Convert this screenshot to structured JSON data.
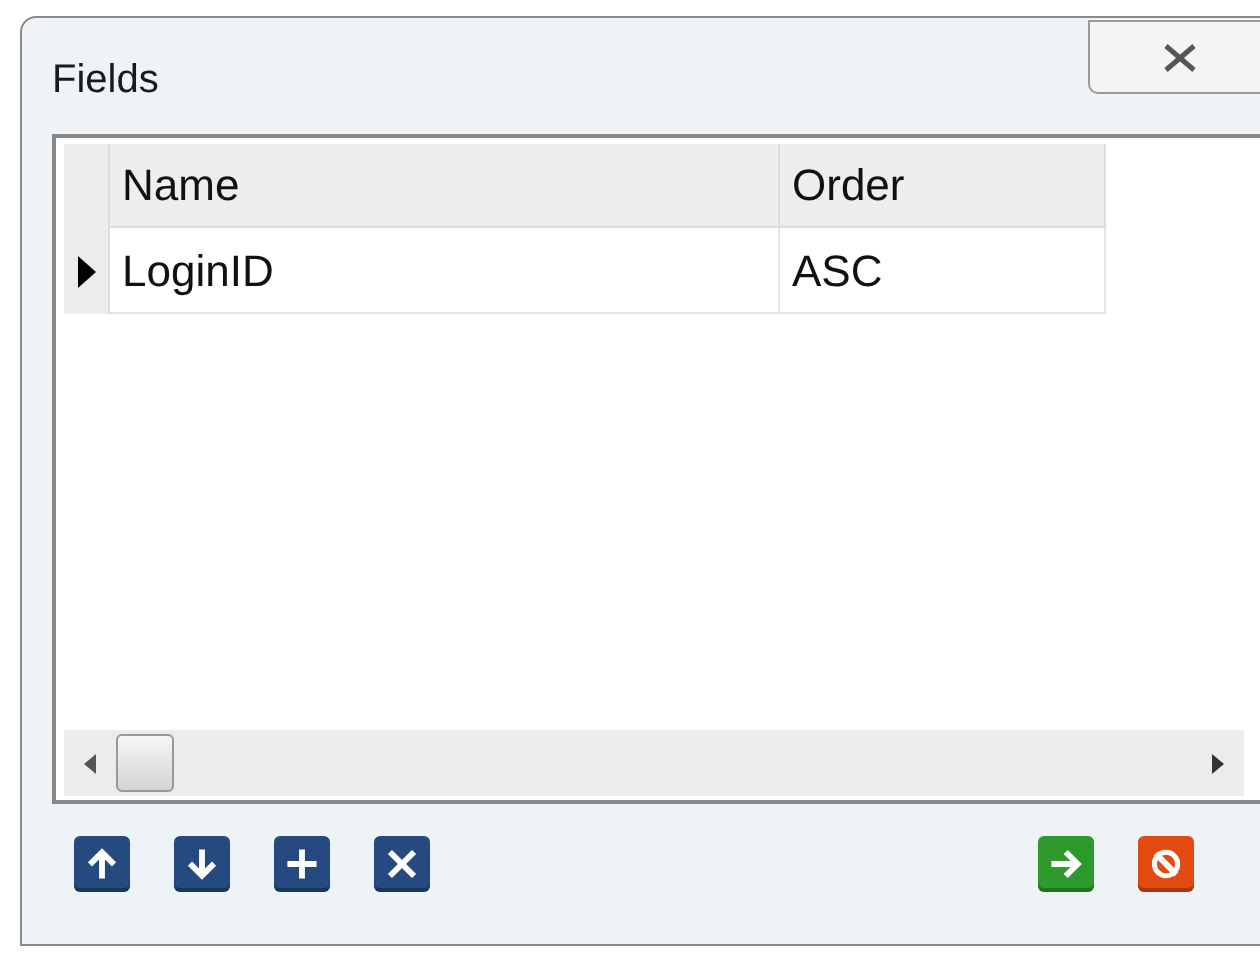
{
  "window": {
    "title": "Fields"
  },
  "table": {
    "columns": [
      "Name",
      "Order"
    ],
    "rows": [
      {
        "cells": [
          "LoginID",
          "ASC"
        ],
        "selected": true
      }
    ]
  },
  "toolbar": {
    "left": [
      {
        "kind": "up"
      },
      {
        "kind": "down"
      },
      {
        "kind": "add"
      },
      {
        "kind": "delete"
      }
    ],
    "right": [
      {
        "kind": "ok"
      },
      {
        "kind": "cancel"
      }
    ]
  }
}
